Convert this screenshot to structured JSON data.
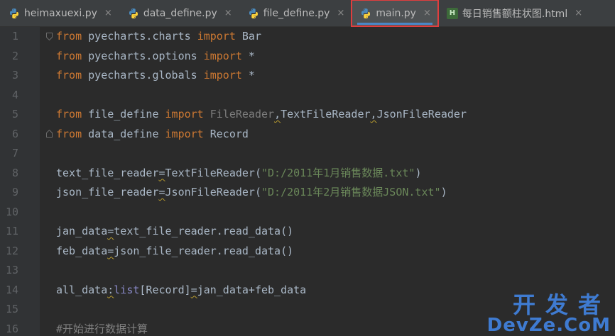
{
  "tabs": [
    {
      "label": "heimaxuexi.py",
      "icon": "python-file-icon",
      "close": "×"
    },
    {
      "label": "data_define.py",
      "icon": "python-file-icon",
      "close": "×"
    },
    {
      "label": "file_define.py",
      "icon": "python-file-icon",
      "close": "×"
    },
    {
      "label": "main.py",
      "icon": "python-file-icon",
      "close": "×",
      "active": true
    },
    {
      "label": "每日销售额柱状图.html",
      "icon": "html-file-icon",
      "icon_text": "H",
      "close": "×"
    }
  ],
  "gutter": {
    "line_numbers": [
      "1",
      "2",
      "3",
      "4",
      "5",
      "6",
      "7",
      "8",
      "9",
      "10",
      "11",
      "12",
      "13",
      "14",
      "15",
      "16"
    ]
  },
  "code": {
    "l1": {
      "kw1": "from",
      "mod": " pyecharts.charts ",
      "kw2": "import",
      "rest": " Bar"
    },
    "l2": {
      "kw1": "from",
      "mod": " pyecharts.options ",
      "kw2": "import",
      "rest": " *"
    },
    "l3": {
      "kw1": "from",
      "mod": " pyecharts.globals ",
      "kw2": "import",
      "rest": " *"
    },
    "l5": {
      "kw1": "from",
      "mod": " file_define ",
      "kw2": "import",
      "unused": " FileReader",
      "c1": ",",
      "n2": "TextFileReader",
      "c2": ",",
      "n3": "JsonFileReader"
    },
    "l6": {
      "kw1": "from",
      "mod": " data_define ",
      "kw2": "import",
      "rest": " Record"
    },
    "l8": {
      "a": "text_file_reader",
      "eq": "=",
      "b": "TextFileReader(",
      "s": "\"D:/2011年1月销售数据.txt\"",
      "c": ")"
    },
    "l9": {
      "a": "json_file_reader",
      "eq": "=",
      "b": "JsonFileReader(",
      "s": "\"D:/2011年2月销售数据JSON.txt\"",
      "c": ")"
    },
    "l11": {
      "a": "jan_data",
      "eq": "=",
      "b": "text_file_reader.read_data()"
    },
    "l12": {
      "a": "feb_data",
      "eq": "=",
      "b": "json_file_reader.read_data()"
    },
    "l14": {
      "a": "all_data",
      "col": ":",
      "t": "list",
      "b": "[Record]",
      "eq": "=",
      "c": "jan_data+feb_data"
    },
    "l16": {
      "comment": "#开始进行数据计算"
    }
  },
  "watermark": {
    "top": "开发者",
    "bottom": "DevZe.CoM"
  }
}
